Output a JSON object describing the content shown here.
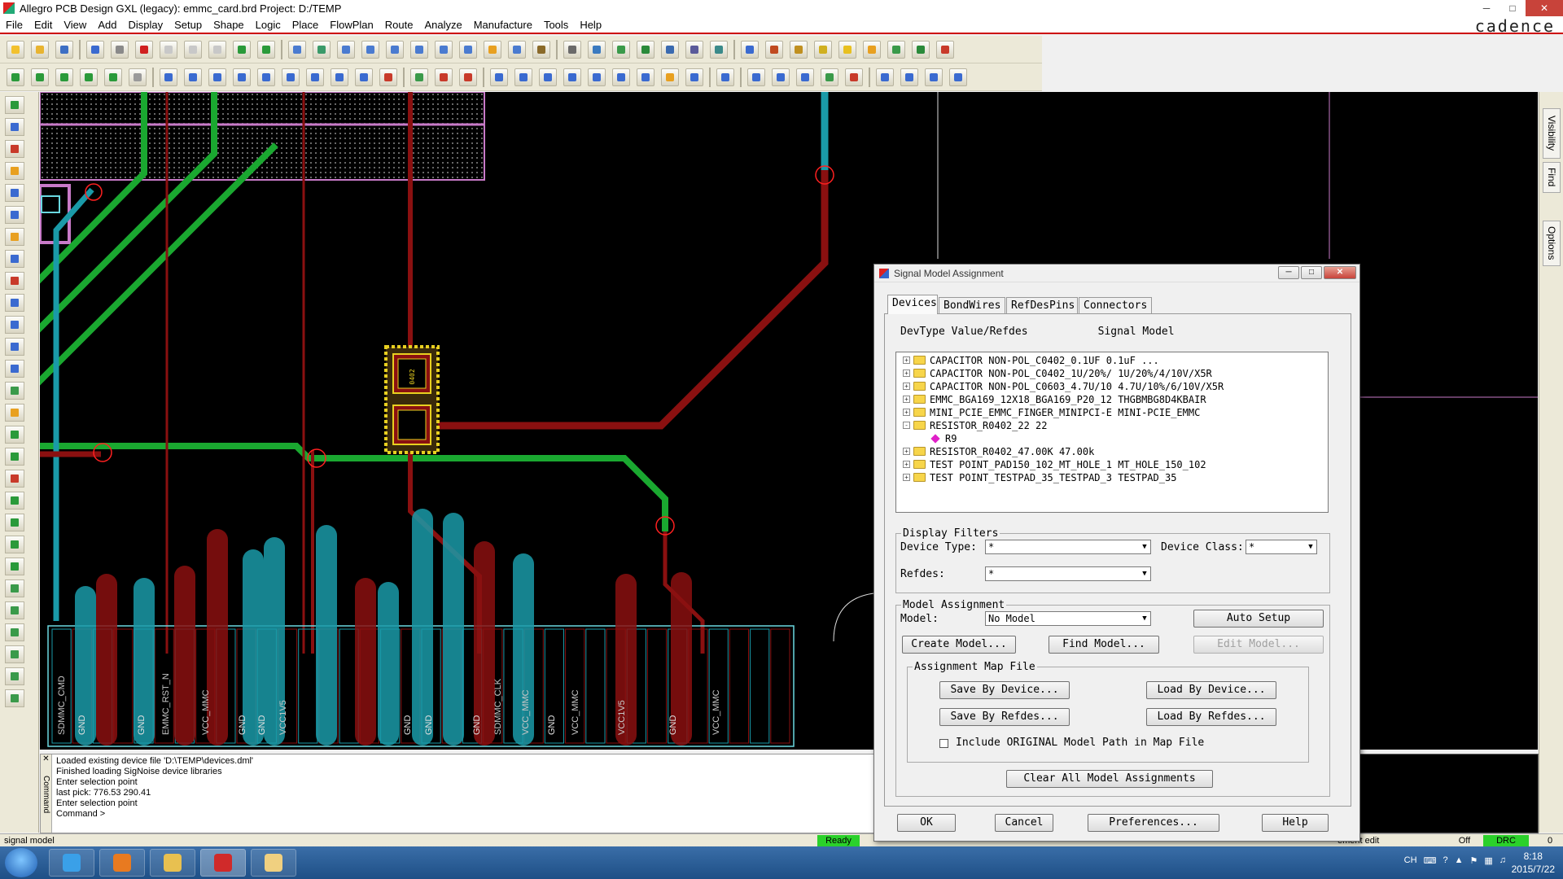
{
  "window": {
    "title": "Allegro PCB Design GXL (legacy): emmc_card.brd  Project: D:/TEMP",
    "brand": "cadence"
  },
  "menu": [
    "File",
    "Edit",
    "View",
    "Add",
    "Display",
    "Setup",
    "Shape",
    "Logic",
    "Place",
    "FlowPlan",
    "Route",
    "Analyze",
    "Manufacture",
    "Tools",
    "Help"
  ],
  "canvas": {
    "pin_labels": [
      "SDMMC_CMD",
      "GND",
      "GND",
      "EMMC_RST_N",
      "VCC_MMC",
      "GND",
      "GND",
      "VCC1V5",
      "GND",
      "GND",
      "GND",
      "SDMMC_CLK",
      "VCC_MMC",
      "GND",
      "VCC_MMC",
      "VCC1V5",
      "GND",
      "VCC_MMC"
    ],
    "component_label": "0402"
  },
  "right_tabs": [
    "Visibility",
    "Find",
    "Options"
  ],
  "command_window": {
    "label": "Command",
    "lines": [
      "Loaded existing device file 'D:\\TEMP\\devices.dml'",
      "Finished loading SigNoise device libraries",
      "Enter selection point",
      "last pick:  776.53  290.41",
      "Enter selection point",
      "Command >"
    ]
  },
  "statusbar": {
    "left": "signal model",
    "ready": "Ready",
    "command": "ement edit",
    "off": "Off",
    "drc": "DRC",
    "zero": "0"
  },
  "taskbar": {
    "lang": "CH",
    "time": "8:18",
    "date": "2015/7/22"
  },
  "dialog": {
    "title": "Signal Model Assignment",
    "tabs": [
      "Devices",
      "BondWires",
      "RefDesPins",
      "Connectors"
    ],
    "column_header": "DevType Value/Refdes           Signal Model",
    "tree": [
      {
        "expand": "+",
        "text": "CAPACITOR NON-POL_C0402_0.1UF 0.1uF ..."
      },
      {
        "expand": "+",
        "text": "CAPACITOR NON-POL_C0402_1U/20%/ 1U/20%/4/10V/X5R"
      },
      {
        "expand": "+",
        "text": "CAPACITOR NON-POL_C0603_4.7U/10 4.7U/10%/6/10V/X5R"
      },
      {
        "expand": "+",
        "text": "EMMC_BGA169_12X18_BGA169_P20_12 THGBMBG8D4KBAIR"
      },
      {
        "expand": "+",
        "text": "MINI_PCIE_EMMC_FINGER_MINIPCI-E MINI-PCIE_EMMC"
      },
      {
        "expand": "-",
        "text": "RESISTOR_R0402_22 22"
      },
      {
        "expand": "",
        "text": "R9",
        "child": true
      },
      {
        "expand": "+",
        "text": "RESISTOR_R0402_47.00K 47.00k"
      },
      {
        "expand": "+",
        "text": "TEST POINT_PAD150_102_MT_HOLE_1 MT_HOLE_150_102"
      },
      {
        "expand": "+",
        "text": "TEST POINT_TESTPAD_35_TESTPAD_3 TESTPAD_35"
      }
    ],
    "display_filters": {
      "title": "Display Filters",
      "device_type_label": "Device Type:",
      "device_type_value": "*",
      "device_class_label": "Device Class:",
      "device_class_value": "*",
      "refdes_label": "Refdes:",
      "refdes_value": "*"
    },
    "model_assignment": {
      "title": "Model Assignment",
      "model_label": "Model:",
      "model_value": "No Model",
      "auto_setup": "Auto Setup",
      "create_model": "Create Model...",
      "find_model": "Find Model...",
      "edit_model": "Edit Model..."
    },
    "map_file": {
      "title": "Assignment Map File",
      "save_by_device": "Save By Device...",
      "load_by_device": "Load By Device...",
      "save_by_refdes": "Save By Refdes...",
      "load_by_refdes": "Load By Refdes...",
      "include_label": "Include ORIGINAL Model Path in Map File"
    },
    "clear_all": "Clear All Model Assignments",
    "ok": "OK",
    "cancel": "Cancel",
    "preferences": "Preferences...",
    "help": "Help"
  }
}
